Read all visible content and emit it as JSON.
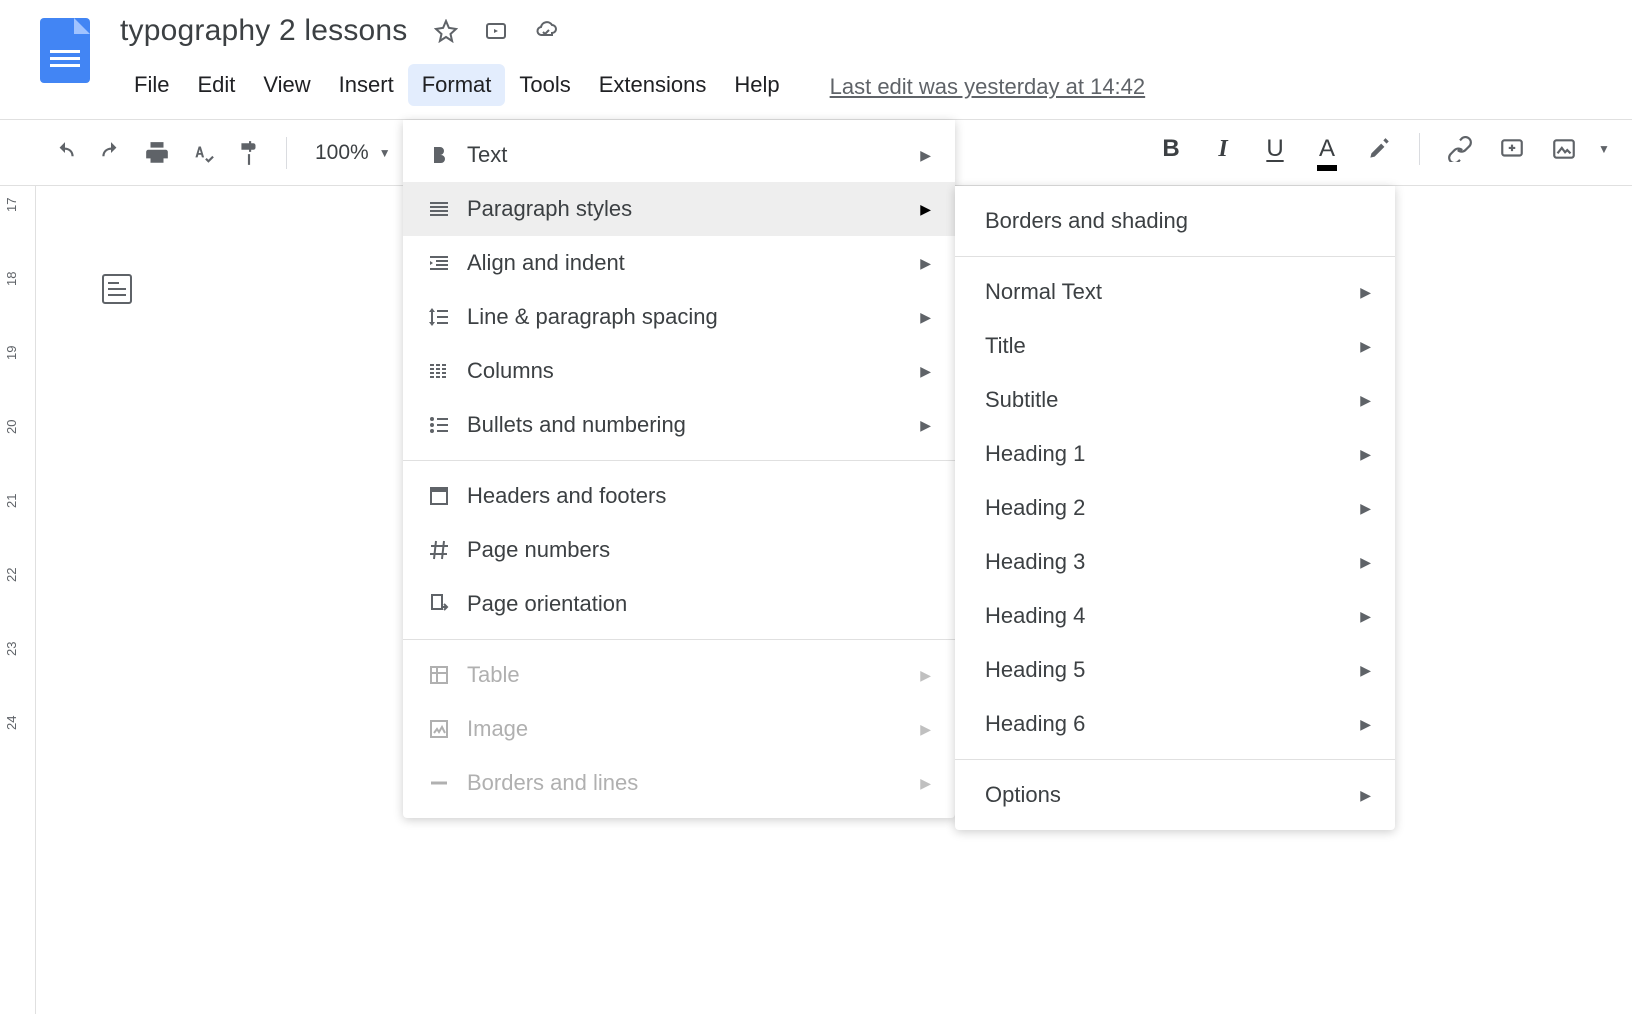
{
  "header": {
    "title": "typography 2 lessons",
    "menubar": [
      "File",
      "Edit",
      "View",
      "Insert",
      "Format",
      "Tools",
      "Extensions",
      "Help"
    ],
    "edit_info": "Last edit was yesterday at 14:42"
  },
  "toolbar": {
    "zoom": "100%"
  },
  "ruler": {
    "ticks": [
      17,
      18,
      19,
      20,
      21,
      22,
      23,
      24
    ]
  },
  "format_menu": {
    "items": [
      {
        "label": "Text",
        "icon": "bold",
        "submenu": true
      },
      {
        "label": "Paragraph styles",
        "icon": "paragraph",
        "submenu": true,
        "highlighted": true
      },
      {
        "label": "Align and indent",
        "icon": "indent",
        "submenu": true
      },
      {
        "label": "Line & paragraph spacing",
        "icon": "linespacing",
        "submenu": true
      },
      {
        "label": "Columns",
        "icon": "columns",
        "submenu": true
      },
      {
        "label": "Bullets and numbering",
        "icon": "bullets",
        "submenu": true
      },
      {
        "divider": true
      },
      {
        "label": "Headers and footers",
        "icon": "headerfooter"
      },
      {
        "label": "Page numbers",
        "icon": "hash"
      },
      {
        "label": "Page orientation",
        "icon": "orientation"
      },
      {
        "divider": true
      },
      {
        "label": "Table",
        "icon": "table",
        "submenu": true,
        "disabled": true
      },
      {
        "label": "Image",
        "icon": "image",
        "submenu": true,
        "disabled": true
      },
      {
        "label": "Borders and lines",
        "icon": "line",
        "submenu": true,
        "disabled": true
      }
    ]
  },
  "paragraph_menu": {
    "items": [
      {
        "label": "Borders and shading"
      },
      {
        "divider": true
      },
      {
        "label": "Normal Text",
        "submenu": true
      },
      {
        "label": "Title",
        "submenu": true
      },
      {
        "label": "Subtitle",
        "submenu": true
      },
      {
        "label": "Heading 1",
        "submenu": true
      },
      {
        "label": "Heading 2",
        "submenu": true
      },
      {
        "label": "Heading 3",
        "submenu": true
      },
      {
        "label": "Heading 4",
        "submenu": true
      },
      {
        "label": "Heading 5",
        "submenu": true
      },
      {
        "label": "Heading 6",
        "submenu": true
      },
      {
        "divider": true
      },
      {
        "label": "Options",
        "submenu": true
      }
    ]
  }
}
